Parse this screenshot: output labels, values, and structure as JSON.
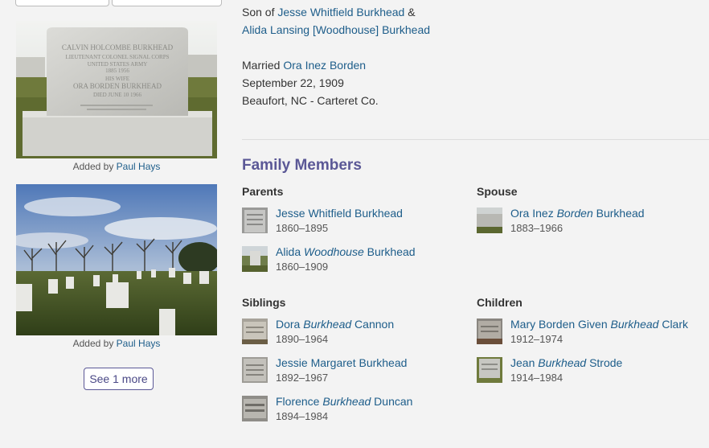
{
  "info": {
    "son_of_prefix": "Son of ",
    "father": "Jesse Whitfield Burkhead",
    "amp": " &",
    "mother": "Alida Lansing [Woodhouse] Burkhead",
    "married_prefix": "Married ",
    "spouse": "Ora Inez Borden",
    "married_date": "September 22, 1909",
    "married_place": "Beaufort, NC - Carteret Co."
  },
  "photos": [
    {
      "added_by_label": "Added by ",
      "added_by_name": "Paul Hays"
    },
    {
      "added_by_label": "Added by ",
      "added_by_name": "Paul Hays"
    }
  ],
  "see_more_label": "See 1 more",
  "family": {
    "title": "Family Members",
    "parents": {
      "heading": "Parents",
      "members": [
        {
          "pre": "Jesse Whitfield Burkhead",
          "em": "",
          "post": "",
          "dates": "1860–1895"
        },
        {
          "pre": "Alida ",
          "em": "Woodhouse",
          "post": " Burkhead",
          "dates": "1860–1909"
        }
      ]
    },
    "spouse": {
      "heading": "Spouse",
      "members": [
        {
          "pre": "Ora Inez ",
          "em": "Borden",
          "post": " Burkhead",
          "dates": "1883–1966"
        }
      ]
    },
    "siblings": {
      "heading": "Siblings",
      "members": [
        {
          "pre": "Dora ",
          "em": "Burkhead",
          "post": " Cannon",
          "dates": "1890–1964"
        },
        {
          "pre": "Jessie Margaret Burkhead",
          "em": "",
          "post": "",
          "dates": "1892–1967"
        },
        {
          "pre": "Florence ",
          "em": "Burkhead",
          "post": " Duncan",
          "dates": "1894–1984"
        }
      ]
    },
    "children": {
      "heading": "Children",
      "members": [
        {
          "pre": "Mary Borden Given ",
          "em": "Burkhead",
          "post": " Clark",
          "dates": "1912–1974"
        },
        {
          "pre": "Jean ",
          "em": "Burkhead",
          "post": " Strode",
          "dates": "1914–1984"
        }
      ]
    }
  },
  "headstone_text": {
    "line1": "CALVIN HOLCOMBE BURKHEAD",
    "line2": "LIEUTENANT COLONEL SIGNAL CORPS",
    "line3": "UNITED STATES ARMY",
    "line4": "1885          1956",
    "line5": "HIS WIFE",
    "line6": "ORA BORDEN BURKHEAD",
    "line7": "DIED JUNE 10 1966"
  },
  "colors": {
    "link": "#1d5d8a",
    "accent": "#5b5896",
    "background": "#f3f3f3"
  }
}
